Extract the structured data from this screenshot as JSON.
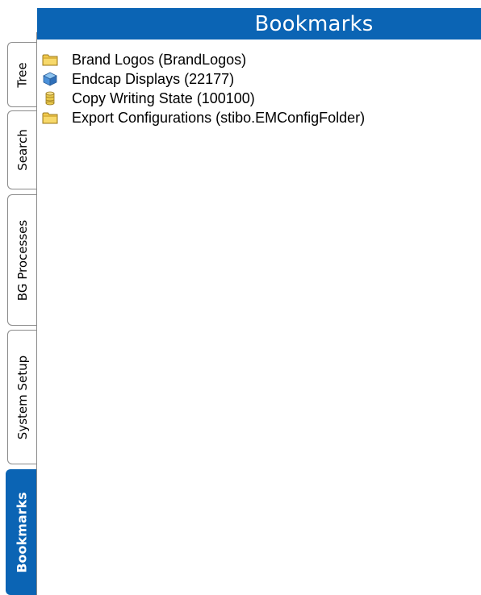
{
  "tabs": [
    {
      "label": "Tree",
      "active": false
    },
    {
      "label": "Search",
      "active": false
    },
    {
      "label": "BG Processes",
      "active": false
    },
    {
      "label": "System Setup",
      "active": false
    },
    {
      "label": "Bookmarks",
      "active": true
    }
  ],
  "panel": {
    "title": "Bookmarks"
  },
  "bookmarks": [
    {
      "label": "Brand Logos (BrandLogos)",
      "icon": "folder-icon"
    },
    {
      "label": "Endcap Displays (22177)",
      "icon": "cube-icon"
    },
    {
      "label": "Copy Writing State (100100)",
      "icon": "cylinder-icon"
    },
    {
      "label": "Export Configurations (stibo.EMConfigFolder)",
      "icon": "folder-icon"
    }
  ],
  "colors": {
    "accent": "#0b64b4",
    "folder": "#f2c94c",
    "cube": "#4a90d9",
    "cylinder": "#e8c84a"
  }
}
